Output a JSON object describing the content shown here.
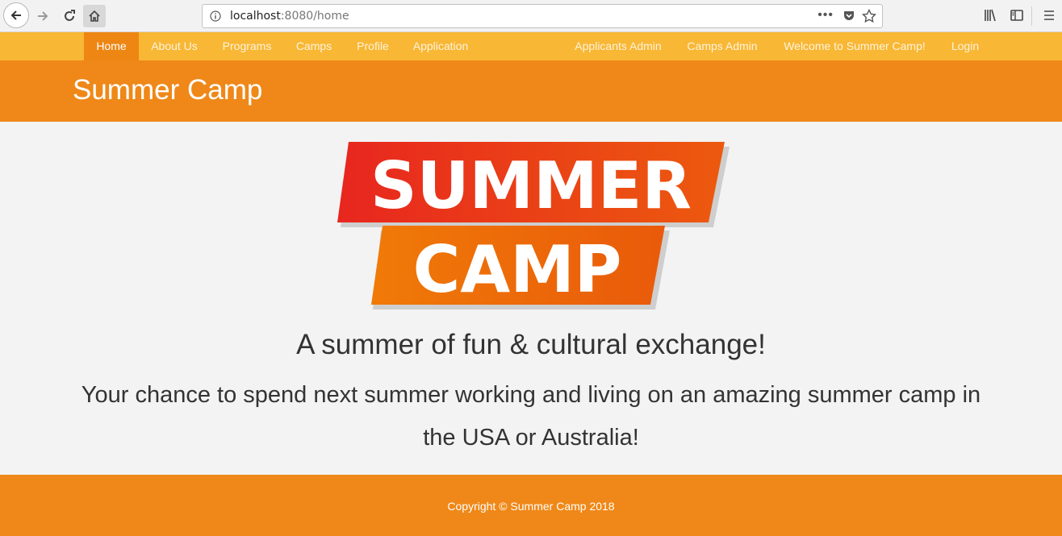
{
  "browser": {
    "url_host": "localhost",
    "url_rest": ":8080/home"
  },
  "navbar": {
    "left_items": [
      "Home",
      "About Us",
      "Programs",
      "Camps",
      "Profile",
      "Application"
    ],
    "right_items": [
      "Applicants Admin",
      "Camps Admin",
      "Welcome to Summer Camp!",
      "Login"
    ],
    "active": "Home"
  },
  "header": {
    "title": "Summer Camp"
  },
  "logo": {
    "line1": "SUMMER",
    "line2": "CAMP"
  },
  "main": {
    "tagline": "A summer of fun & cultural exchange!",
    "subtext": "Your chance to spend next summer working and living on an amazing summer camp in the USA or Australia!"
  },
  "footer": {
    "copyright": "Copyright © Summer Camp 2018"
  },
  "colors": {
    "navbar": "#f8b734",
    "active": "#ed8613",
    "header": "#ef8818",
    "logo_red": "#e8261f",
    "logo_orange": "#ef7a0a"
  }
}
